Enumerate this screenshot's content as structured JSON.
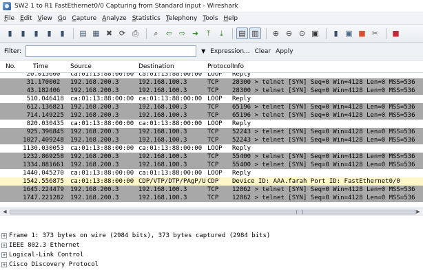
{
  "window": {
    "title": "SW2 1 to R1 FastEthernet0/0 Capturing from Standard input - Wireshark"
  },
  "menu": [
    "File",
    "Edit",
    "View",
    "Go",
    "Capture",
    "Analyze",
    "Statistics",
    "Telephony",
    "Tools",
    "Help"
  ],
  "toolbar_icons": [
    {
      "name": "interfaces-icon",
      "glyph": "▮",
      "color": "#3a4f6a"
    },
    {
      "name": "options-icon",
      "glyph": "▮",
      "color": "#3a4f6a"
    },
    {
      "name": "start-capture-icon",
      "glyph": "▮",
      "color": "#3a4f6a"
    },
    {
      "name": "stop-capture-icon",
      "glyph": "▮",
      "color": "#3a4f6a"
    },
    {
      "name": "restart-capture-icon",
      "glyph": "▮",
      "color": "#3a4f6a"
    },
    {
      "name": "sep"
    },
    {
      "name": "open-file-icon",
      "glyph": "▤",
      "color": "#4b5d73"
    },
    {
      "name": "save-file-icon",
      "glyph": "▦",
      "color": "#4b5d73"
    },
    {
      "name": "close-file-icon",
      "glyph": "✖",
      "color": "#444"
    },
    {
      "name": "reload-icon",
      "glyph": "⟳",
      "color": "#444"
    },
    {
      "name": "print-icon",
      "glyph": "⎙",
      "color": "#444"
    },
    {
      "name": "sep"
    },
    {
      "name": "find-packet-icon",
      "glyph": "⌕",
      "color": "#333"
    },
    {
      "name": "go-back-icon",
      "glyph": "⇦",
      "color": "#3c8a2e"
    },
    {
      "name": "go-forward-icon",
      "glyph": "⇨",
      "color": "#3c8a2e"
    },
    {
      "name": "go-to-packet-icon",
      "glyph": "➜",
      "color": "#3c8a2e"
    },
    {
      "name": "first-packet-icon",
      "glyph": "⤒",
      "color": "#3c8a2e"
    },
    {
      "name": "last-packet-icon",
      "glyph": "⤓",
      "color": "#3c8a2e"
    },
    {
      "name": "sep"
    },
    {
      "name": "colorize-icon",
      "glyph": "▤",
      "color": "#333",
      "pressed": true
    },
    {
      "name": "auto-scroll-icon",
      "glyph": "▥",
      "color": "#333",
      "pressed": true
    },
    {
      "name": "sep"
    },
    {
      "name": "zoom-in-icon",
      "glyph": "⊕",
      "color": "#333"
    },
    {
      "name": "zoom-out-icon",
      "glyph": "⊖",
      "color": "#333"
    },
    {
      "name": "normal-size-icon",
      "glyph": "⊙",
      "color": "#333"
    },
    {
      "name": "resize-columns-icon",
      "glyph": "▣",
      "color": "#333"
    },
    {
      "name": "sep"
    },
    {
      "name": "capture-filters-icon",
      "glyph": "▮",
      "color": "#3a4f6a"
    },
    {
      "name": "display-filters-icon",
      "glyph": "▣",
      "color": "#4d6a8a"
    },
    {
      "name": "coloring-rules-icon",
      "glyph": "■",
      "color": "#d8502e"
    },
    {
      "name": "preferences-icon",
      "glyph": "✂",
      "color": "#555"
    },
    {
      "name": "sep"
    },
    {
      "name": "help-icon",
      "glyph": "■",
      "color": "#c4283a"
    }
  ],
  "filter": {
    "label": "Filter:",
    "value": "",
    "expression_label": "Expression...",
    "clear_label": "Clear",
    "apply_label": "Apply"
  },
  "columns": {
    "no": "No.",
    "time": "Time",
    "source": "Source",
    "destination": "Destination",
    "protocol": "Protocol",
    "info": "Info"
  },
  "colors": {
    "tcp_row_bg": "#a8a8a8",
    "selected_row_bg": "#fff6c9",
    "default_row_bg": "#ffffff"
  },
  "packets": [
    {
      "no": "2",
      "time": "0.015600",
      "source": "ca:01:13:88:00:00",
      "destination": "ca:01:13:88:00:00",
      "protocol": "LOOP",
      "info": "Reply",
      "style": "plain"
    },
    {
      "no": "3",
      "time": "1.170002",
      "source": "192.168.200.3",
      "destination": "192.168.100.3",
      "protocol": "TCP",
      "info": "28300 > telnet [SYN] Seq=0 Win=4128 Len=0 MSS=536",
      "style": "tcp"
    },
    {
      "no": "4",
      "time": "3.182406",
      "source": "192.168.200.3",
      "destination": "192.168.100.3",
      "protocol": "TCP",
      "info": "28300 > telnet [SYN] Seq=0 Win=4128 Len=0 MSS=536",
      "style": "tcp"
    },
    {
      "no": "5",
      "time": "10.046418",
      "source": "ca:01:13:88:00:00",
      "destination": "ca:01:13:88:00:00",
      "protocol": "LOOP",
      "info": "Reply",
      "style": "plain"
    },
    {
      "no": "6",
      "time": "12.136821",
      "source": "192.168.200.3",
      "destination": "192.168.100.3",
      "protocol": "TCP",
      "info": "65196 > telnet [SYN] Seq=0 Win=4128 Len=0 MSS=536",
      "style": "tcp"
    },
    {
      "no": "7",
      "time": "14.149225",
      "source": "192.168.200.3",
      "destination": "192.168.100.3",
      "protocol": "TCP",
      "info": "65196 > telnet [SYN] Seq=0 Win=4128 Len=0 MSS=536",
      "style": "tcp"
    },
    {
      "no": "8",
      "time": "20.030435",
      "source": "ca:01:13:88:00:00",
      "destination": "ca:01:13:88:00:00",
      "protocol": "LOOP",
      "info": "Reply",
      "style": "plain"
    },
    {
      "no": "9",
      "time": "25.396845",
      "source": "192.168.200.3",
      "destination": "192.168.100.3",
      "protocol": "TCP",
      "info": "52243 > telnet [SYN] Seq=0 Win=4128 Len=0 MSS=536",
      "style": "tcp"
    },
    {
      "no": "10",
      "time": "27.409248",
      "source": "192.168.200.3",
      "destination": "192.168.100.3",
      "protocol": "TCP",
      "info": "52243 > telnet [SYN] Seq=0 Win=4128 Len=0 MSS=536",
      "style": "tcp"
    },
    {
      "no": "11",
      "time": "30.030053",
      "source": "ca:01:13:88:00:00",
      "destination": "ca:01:13:88:00:00",
      "protocol": "LOOP",
      "info": "Reply",
      "style": "plain"
    },
    {
      "no": "12",
      "time": "32.869258",
      "source": "192.168.200.3",
      "destination": "192.168.100.3",
      "protocol": "TCP",
      "info": "55400 > telnet [SYN] Seq=0 Win=4128 Len=0 MSS=536",
      "style": "tcp"
    },
    {
      "no": "13",
      "time": "34.881661",
      "source": "192.168.200.3",
      "destination": "192.168.100.3",
      "protocol": "TCP",
      "info": "55400 > telnet [SYN] Seq=0 Win=4128 Len=0 MSS=536",
      "style": "tcp"
    },
    {
      "no": "14",
      "time": "40.045270",
      "source": "ca:01:13:88:00:00",
      "destination": "ca:01:13:88:00:00",
      "protocol": "LOOP",
      "info": "Reply",
      "style": "plain"
    },
    {
      "no": "15",
      "time": "42.556875",
      "source": "ca:01:13:88:00:00",
      "destination": "CDP/VTP/DTP/PAgP/UD",
      "protocol": "CDP",
      "info": "Device ID: AAA.farah  Port ID: FastEthernet0/0",
      "style": "selected"
    },
    {
      "no": "16",
      "time": "45.224479",
      "source": "192.168.200.3",
      "destination": "192.168.100.3",
      "protocol": "TCP",
      "info": "12862 > telnet [SYN] Seq=0 Win=4128 Len=0 MSS=536",
      "style": "tcp"
    },
    {
      "no": "17",
      "time": "47.221282",
      "source": "192.168.200.3",
      "destination": "192.168.100.3",
      "protocol": "TCP",
      "info": "12862 > telnet [SYN] Seq=0 Win=4128 Len=0 MSS=536",
      "style": "tcp"
    }
  ],
  "details": [
    "Frame 1: 373 bytes on wire (2984 bits), 373 bytes captured (2984 bits)",
    "IEEE 802.3 Ethernet",
    "Logical-Link Control",
    "Cisco Discovery Protocol"
  ]
}
